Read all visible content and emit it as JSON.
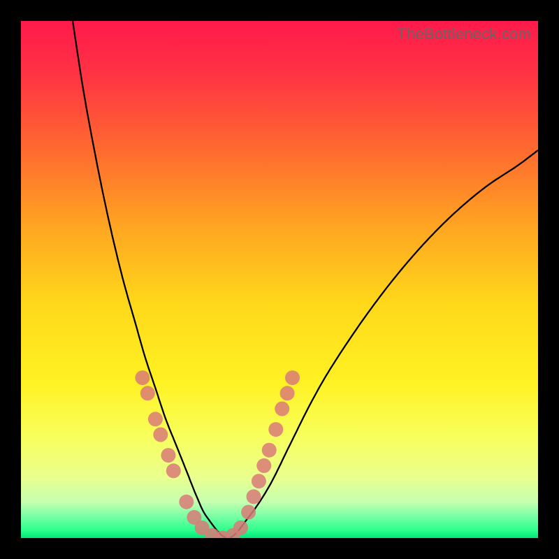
{
  "watermark": "TheBottleneck.com",
  "chart_data": {
    "type": "line",
    "title": "",
    "xlabel": "",
    "ylabel": "",
    "xlim": [
      0,
      100
    ],
    "ylim": [
      0,
      100
    ],
    "gradient_stops": [
      {
        "offset": 0.0,
        "color": "#ff1a4b"
      },
      {
        "offset": 0.1,
        "color": "#ff3244"
      },
      {
        "offset": 0.25,
        "color": "#ff6a2f"
      },
      {
        "offset": 0.4,
        "color": "#ffa621"
      },
      {
        "offset": 0.55,
        "color": "#ffd91a"
      },
      {
        "offset": 0.7,
        "color": "#fff223"
      },
      {
        "offset": 0.8,
        "color": "#f8ff5a"
      },
      {
        "offset": 0.88,
        "color": "#eaff8c"
      },
      {
        "offset": 0.93,
        "color": "#c6ffb0"
      },
      {
        "offset": 0.96,
        "color": "#73ffa4"
      },
      {
        "offset": 0.985,
        "color": "#2cff8d"
      },
      {
        "offset": 1.0,
        "color": "#00e676"
      }
    ],
    "series": [
      {
        "name": "bottleneck-curve",
        "x": [
          10,
          12,
          14,
          16,
          18,
          20,
          22,
          24,
          26,
          28,
          30,
          32,
          34,
          36,
          40,
          44,
          48,
          52,
          56,
          60,
          66,
          72,
          78,
          84,
          90,
          96,
          100
        ],
        "y": [
          100,
          87,
          76,
          66,
          57,
          49,
          42,
          35,
          29,
          23,
          18,
          13,
          8,
          4,
          0,
          4,
          10,
          18,
          26,
          33,
          42,
          50,
          57,
          63,
          68,
          72,
          75
        ]
      }
    ],
    "highlight_points": {
      "name": "marker-dots",
      "color": "#d97a78",
      "points": [
        {
          "x": 23.5,
          "y": 31
        },
        {
          "x": 24.5,
          "y": 28
        },
        {
          "x": 26.0,
          "y": 23
        },
        {
          "x": 27.0,
          "y": 20
        },
        {
          "x": 28.5,
          "y": 16
        },
        {
          "x": 29.5,
          "y": 13
        },
        {
          "x": 32.0,
          "y": 7
        },
        {
          "x": 33.5,
          "y": 4
        },
        {
          "x": 35.0,
          "y": 2
        },
        {
          "x": 37.0,
          "y": 0.5
        },
        {
          "x": 39.0,
          "y": 0
        },
        {
          "x": 41.0,
          "y": 0.5
        },
        {
          "x": 42.5,
          "y": 2
        },
        {
          "x": 44.0,
          "y": 5
        },
        {
          "x": 45.0,
          "y": 8
        },
        {
          "x": 46.0,
          "y": 11
        },
        {
          "x": 47.0,
          "y": 14
        },
        {
          "x": 48.0,
          "y": 17
        },
        {
          "x": 49.3,
          "y": 21
        },
        {
          "x": 50.5,
          "y": 25
        },
        {
          "x": 51.5,
          "y": 28
        },
        {
          "x": 52.5,
          "y": 31
        }
      ]
    },
    "minimum": {
      "x": 39,
      "y": 0
    }
  }
}
